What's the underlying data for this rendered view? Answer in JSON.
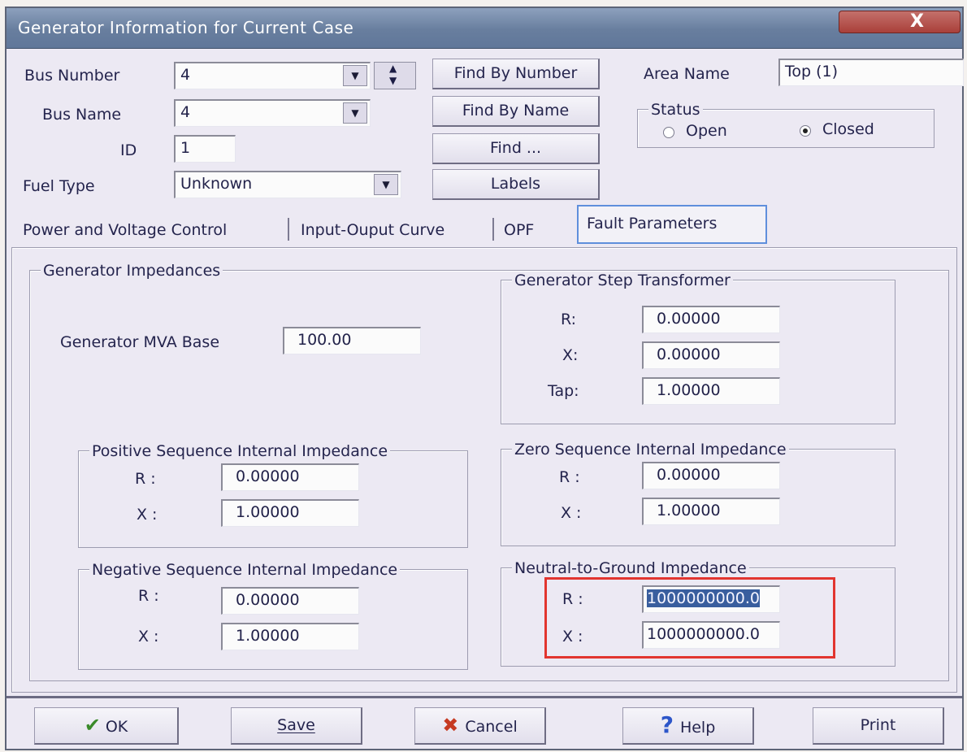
{
  "window": {
    "title": "Generator Information for Current Case",
    "close_glyph": "X"
  },
  "header": {
    "bus_number_label": "Bus Number",
    "bus_number_value": "4",
    "bus_name_label": "Bus Name",
    "bus_name_value": "4",
    "id_label": "ID",
    "id_value": "1",
    "fuel_type_label": "Fuel Type",
    "fuel_type_value": "Unknown",
    "find_by_number": "Find By Number",
    "find_by_name": "Find By Name",
    "find": "Find ...",
    "labels": "Labels",
    "area_name_label": "Area Name",
    "area_name_value": "Top (1)",
    "status": {
      "title": "Status",
      "open": "Open",
      "closed": "Closed",
      "selected": "Closed"
    }
  },
  "tabs": [
    {
      "label": "Power and Voltage Control"
    },
    {
      "label": "Input-Ouput Curve"
    },
    {
      "label": "OPF"
    },
    {
      "label": "Fault Parameters",
      "active": true
    }
  ],
  "fault": {
    "impedances_title": "Generator Impedances",
    "mva_base_label": "Generator MVA Base",
    "mva_base_value": "100.00",
    "step_transformer": {
      "title": "Generator Step Transformer",
      "r_label": "R:",
      "r_value": "0.00000",
      "x_label": "X:",
      "x_value": "0.00000",
      "tap_label": "Tap:",
      "tap_value": "1.00000"
    },
    "positive": {
      "title": "Positive Sequence Internal Impedance",
      "r_label": "R :",
      "r_value": "0.00000",
      "x_label": "X :",
      "x_value": "1.00000"
    },
    "zero": {
      "title": "Zero Sequence Internal Impedance",
      "r_label": "R :",
      "r_value": "0.00000",
      "x_label": "X :",
      "x_value": "1.00000"
    },
    "negative": {
      "title": "Negative Sequence Internal Impedance",
      "r_label": "R :",
      "r_value": "0.00000",
      "x_label": "X :",
      "x_value": "1.00000"
    },
    "neutral": {
      "title": "Neutral-to-Ground Impedance",
      "r_label": "R :",
      "r_value": "1000000000.0",
      "x_label": "X :",
      "x_value": "1000000000.0"
    }
  },
  "footer": {
    "ok": "OK",
    "save": "Save",
    "cancel": "Cancel",
    "help": "Help",
    "print": "Print"
  },
  "colors": {
    "highlight_box": "#e2352f",
    "ok_check": "#3a8a2a",
    "cancel_x": "#c63a22",
    "help_q": "#2d56c9"
  },
  "icons": [
    "close-icon",
    "chevron-down-icon",
    "spin-up-icon",
    "spin-down-icon",
    "check-icon",
    "x-icon",
    "question-icon"
  ]
}
